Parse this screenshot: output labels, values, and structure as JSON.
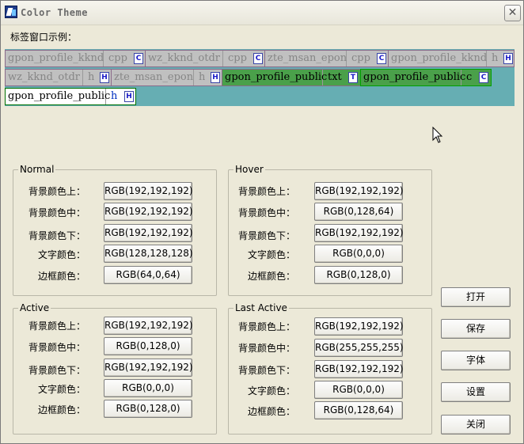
{
  "window": {
    "title": "Color Theme",
    "close_glyph": "✕"
  },
  "tabs_label": "标签窗口示例：",
  "tabs": [
    {
      "name": "gpon_profile_kknd",
      "ext": "cpp",
      "icon": "C"
    },
    {
      "name": "wz_kknd_otdr",
      "ext": "cpp",
      "icon": "C"
    },
    {
      "name": "zte_msan_epon",
      "ext": "cpp",
      "icon": "C"
    },
    {
      "name": "gpon_profile_kknd",
      "ext": "h",
      "icon": "H"
    },
    {
      "name": "wz_kknd_otdr",
      "ext": "h",
      "icon": "H"
    },
    {
      "name": "zte_msan_epon",
      "ext": "h",
      "icon": "H"
    },
    {
      "name": "gpon_profile_public",
      "ext": "txt",
      "icon": "T"
    },
    {
      "name": "gpon_profile_public",
      "ext": "c",
      "icon": "C"
    },
    {
      "name": "gpon_profile_public",
      "ext": "h",
      "icon": "H"
    }
  ],
  "groups": {
    "normal": {
      "title": "Normal",
      "rows": [
        {
          "label": "背景颜色上：",
          "value": "RGB(192,192,192)"
        },
        {
          "label": "背景颜色中：",
          "value": "RGB(192,192,192)"
        },
        {
          "label": "背景颜色下：",
          "value": "RGB(192,192,192)"
        },
        {
          "label": "文字颜色：",
          "value": "RGB(128,128,128)"
        },
        {
          "label": "边框颜色：",
          "value": "RGB(64,0,64)"
        }
      ]
    },
    "hover": {
      "title": "Hover",
      "rows": [
        {
          "label": "背景颜色上：",
          "value": "RGB(192,192,192)"
        },
        {
          "label": "背景颜色中：",
          "value": "RGB(0,128,64)"
        },
        {
          "label": "背景颜色下：",
          "value": "RGB(192,192,192)"
        },
        {
          "label": "文字颜色：",
          "value": "RGB(0,0,0)"
        },
        {
          "label": "边框颜色：",
          "value": "RGB(0,128,0)"
        }
      ]
    },
    "active": {
      "title": "Active",
      "rows": [
        {
          "label": "背景颜色上：",
          "value": "RGB(192,192,192)"
        },
        {
          "label": "背景颜色中：",
          "value": "RGB(0,128,0)"
        },
        {
          "label": "背景颜色下：",
          "value": "RGB(192,192,192)"
        },
        {
          "label": "文字颜色：",
          "value": "RGB(0,0,0)"
        },
        {
          "label": "边框颜色：",
          "value": "RGB(0,128,0)"
        }
      ]
    },
    "last_active": {
      "title": "Last Active",
      "rows": [
        {
          "label": "背景颜色上：",
          "value": "RGB(192,192,192)"
        },
        {
          "label": "背景颜色中：",
          "value": "RGB(255,255,255)"
        },
        {
          "label": "背景颜色下：",
          "value": "RGB(192,192,192)"
        },
        {
          "label": "文字颜色：",
          "value": "RGB(0,0,0)"
        },
        {
          "label": "边框颜色：",
          "value": "RGB(0,128,64)"
        }
      ]
    }
  },
  "buttons": {
    "open": "打开",
    "save": "保存",
    "font": "字体",
    "settings": "设置",
    "close": "关闭"
  },
  "colors": {
    "tabstrip_bg": "#66aeb3",
    "hover_bg": "#4aa04a",
    "window_bg": "#ece9d8"
  }
}
